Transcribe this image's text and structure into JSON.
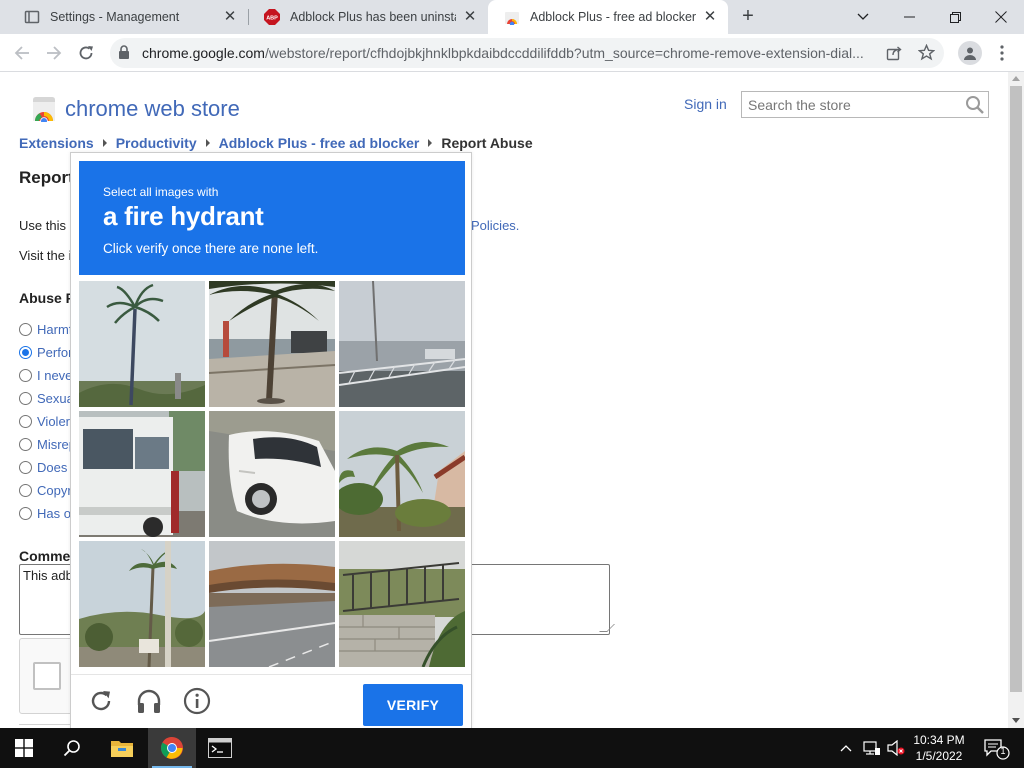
{
  "browser": {
    "tabs": [
      {
        "title": "Settings - Management",
        "icon": "gear-icon",
        "active": false
      },
      {
        "title": "Adblock Plus has been uninstalle",
        "icon": "abp-icon",
        "active": false
      },
      {
        "title": "Adblock Plus - free ad blocker -",
        "icon": "chrome-web-store-icon",
        "active": true
      }
    ],
    "url_host": "chrome.google.com",
    "url_path": "/webstore/report/cfhdojbkjhnklbpkdaibdccddilifddb?utm_source=chrome-remove-extension-dial..."
  },
  "store": {
    "title": "chrome web store",
    "signin": "Sign in",
    "search_placeholder": "Search the store",
    "breadcrumbs": [
      "Extensions",
      "Productivity",
      "Adblock Plus - free ad blocker",
      "Report Abuse"
    ],
    "page_heading": "Report",
    "intro_line1": "Use this",
    "policies_link": "Policies.",
    "intro_line2": "Visit the i",
    "abuse_heading": "Abuse F",
    "abuse_options": [
      {
        "label": "Harmf",
        "checked": false
      },
      {
        "label": "Perfor",
        "checked": true
      },
      {
        "label": "I neve",
        "checked": false
      },
      {
        "label": "Sexua",
        "checked": false
      },
      {
        "label": "Violer",
        "checked": false
      },
      {
        "label": "Misrep",
        "checked": false
      },
      {
        "label": "Does",
        "checked": false
      },
      {
        "label": "Copyr",
        "checked": false
      },
      {
        "label": "Has o",
        "checked": false
      }
    ],
    "comments_heading": "Commen",
    "comments_value": "This adb"
  },
  "captcha": {
    "prompt_small": "Select all images with",
    "prompt_big": "a fire hydrant",
    "prompt_sub": "Click verify once there are none left.",
    "verify_label": "VERIFY",
    "tiles": [
      {
        "name": "palm-tree-tile"
      },
      {
        "name": "palm-street-tile"
      },
      {
        "name": "bridge-railing-tile"
      },
      {
        "name": "white-van-tile"
      },
      {
        "name": "white-car-tile"
      },
      {
        "name": "palm-house-tile"
      },
      {
        "name": "palm-hillside-tile"
      },
      {
        "name": "overpass-road-tile"
      },
      {
        "name": "stone-wall-fence-tile"
      }
    ]
  },
  "taskbar": {
    "time": "10:34 PM",
    "date": "1/5/2022",
    "notification_count": "1"
  }
}
